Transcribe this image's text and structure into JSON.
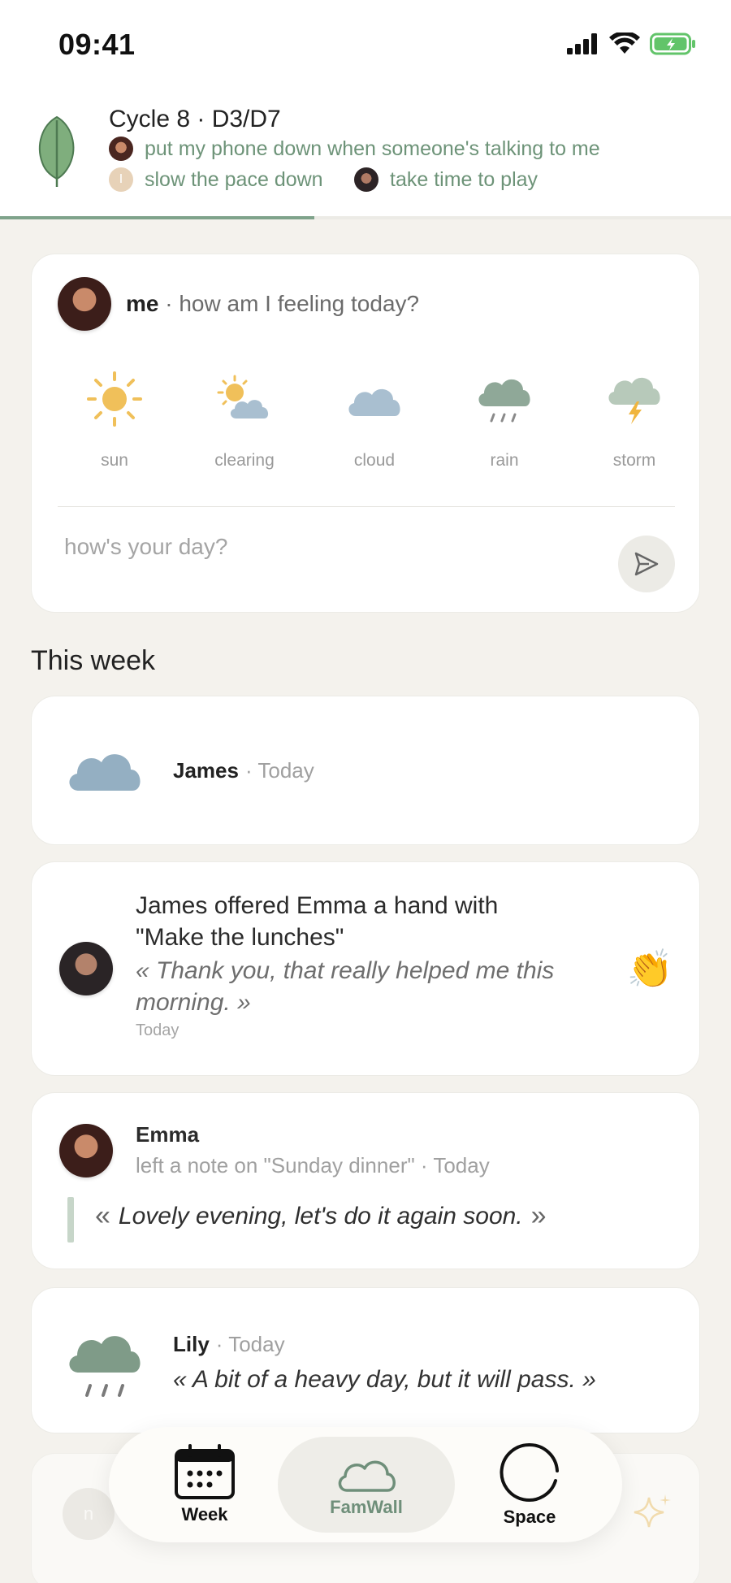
{
  "status_bar": {
    "time": "09:41"
  },
  "cycle": {
    "title": "Cycle 8 · D3/D7",
    "goals": [
      {
        "text": "put my phone down when someone's talking to me"
      },
      {
        "text": "slow the pace down",
        "avatar_initial": "I"
      },
      {
        "text": "take time to play"
      }
    ],
    "progress_fraction": 0.43
  },
  "mood_card": {
    "user": "me",
    "question": "· how am I feeling today?",
    "options": [
      {
        "label": "sun",
        "icon": "sun-icon"
      },
      {
        "label": "clearing",
        "icon": "sun-behind-cloud-icon"
      },
      {
        "label": "cloud",
        "icon": "cloud-icon"
      },
      {
        "label": "rain",
        "icon": "rain-cloud-icon"
      },
      {
        "label": "storm",
        "icon": "storm-cloud-icon"
      }
    ],
    "input_placeholder": "how's your day?"
  },
  "section_title": "This week",
  "feed": {
    "james_mood": {
      "name": "James",
      "time": "· Today",
      "icon": "cloud-icon"
    },
    "offer": {
      "title": "James offered Emma a hand with \"Make the lunches\"",
      "quote": "« Thank you, that really helped me this morning. »",
      "time": "Today",
      "reaction": "👏"
    },
    "note": {
      "name": "Emma",
      "meta": "left a note on \"Sunday dinner\" · Today",
      "quote": "Lovely evening, let's do it again soon.",
      "open_quote": "«",
      "close_quote": "»"
    },
    "lily": {
      "name": "Lily",
      "time": "· Today",
      "quote": "« A bit of a heavy day, but it will pass. »",
      "icon": "rain-cloud-icon"
    },
    "faded": {
      "avatar_initial": "n"
    }
  },
  "tabbar": {
    "tabs": [
      {
        "label": "Week",
        "icon": "calendar-icon"
      },
      {
        "label": "FamWall",
        "icon": "cloud-outline-icon",
        "active": true
      },
      {
        "label": "Space",
        "icon": "circle-icon"
      }
    ]
  },
  "colors": {
    "accent_green": "#6d9378",
    "background": "#f4f2ed",
    "card": "#ffffff"
  }
}
